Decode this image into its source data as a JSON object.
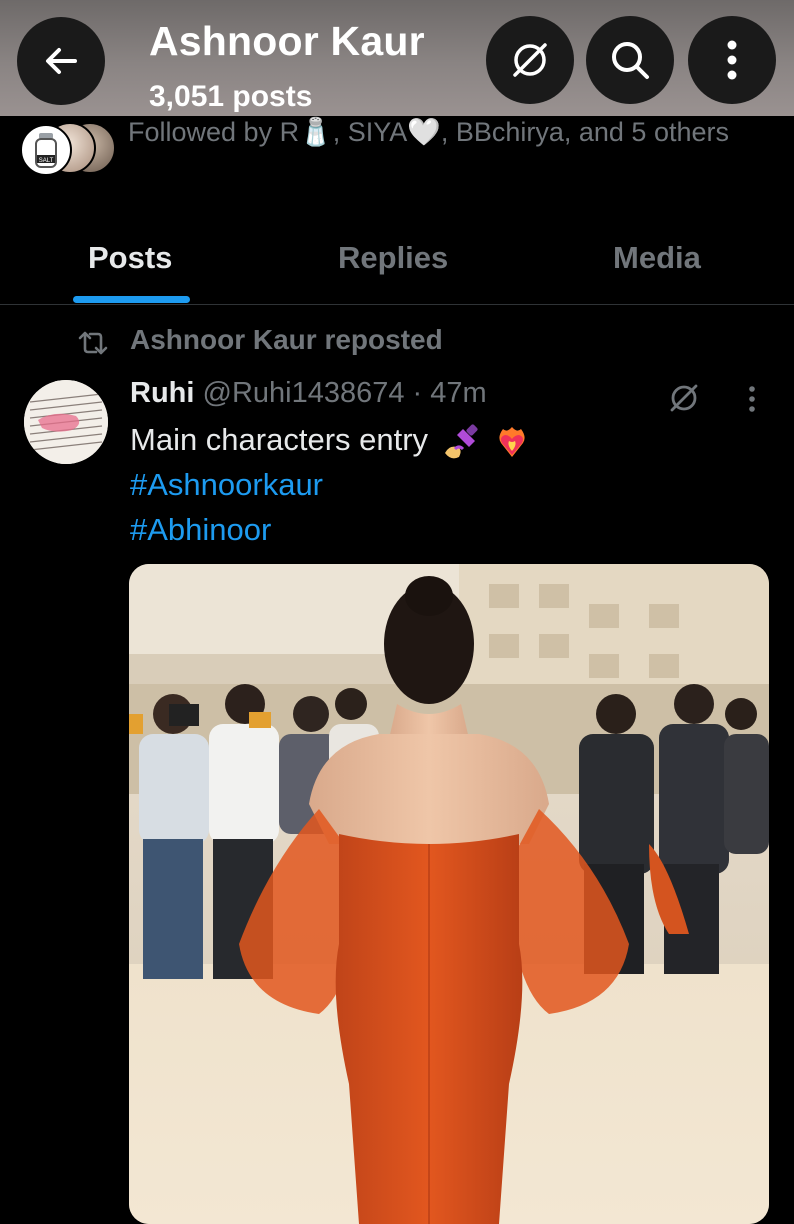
{
  "header": {
    "title": "Ashnoor Kaur",
    "subtitle": "3,051 posts",
    "icons": [
      "arrow-left-icon",
      "grok-icon",
      "search-icon",
      "more-vertical-icon"
    ]
  },
  "followed_by": {
    "text": "Followed by R🧂, SIYA🤍, BBchirya, and 5 others"
  },
  "tabs": [
    {
      "label": "Posts",
      "active": true
    },
    {
      "label": "Replies",
      "active": false
    },
    {
      "label": "Media",
      "active": false
    }
  ],
  "repost": {
    "label": "Ashnoor Kaur reposted",
    "icon": "repost-icon"
  },
  "post": {
    "name": "Ruhi",
    "handle": "@Ruhi1438674",
    "separator": "·",
    "time": "47m",
    "text": "Main characters entry",
    "hashtags": [
      "#Ashnoorkaur",
      "#Abhinoor"
    ],
    "icons": [
      "nail-polish-emoji",
      "heart-on-fire-emoji",
      "grok-icon",
      "more-vertical-icon"
    ]
  },
  "colors": {
    "accent": "#1d9bf0",
    "text_primary": "#e7e9ea",
    "text_secondary": "#71767b",
    "background": "#000000"
  }
}
